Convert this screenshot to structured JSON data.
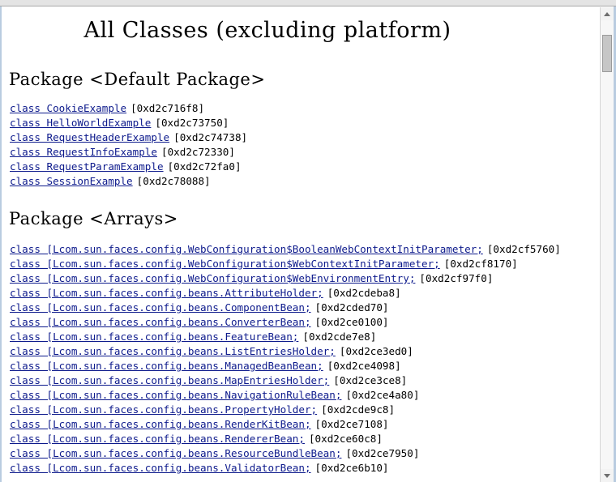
{
  "window": {
    "title": "All Classes (excluding platform)"
  },
  "scrollbar": {
    "up_icon": "arrow-up-icon",
    "down_icon": "arrow-down-icon",
    "thumb": "scroll-thumb"
  },
  "packages": [
    {
      "heading": "Package <Default Package>",
      "classes": [
        {
          "link": "class CookieExample",
          "address": "[0xd2c716f8]"
        },
        {
          "link": "class HelloWorldExample",
          "address": "[0xd2c73750]"
        },
        {
          "link": "class RequestHeaderExample",
          "address": "[0xd2c74738]"
        },
        {
          "link": "class RequestInfoExample",
          "address": "[0xd2c72330]"
        },
        {
          "link": "class RequestParamExample",
          "address": "[0xd2c72fa0]"
        },
        {
          "link": "class SessionExample",
          "address": "[0xd2c78088]"
        }
      ]
    },
    {
      "heading": "Package <Arrays>",
      "classes": [
        {
          "link": "class [Lcom.sun.faces.config.WebConfiguration$BooleanWebContextInitParameter;",
          "address": "[0xd2cf5760]"
        },
        {
          "link": "class [Lcom.sun.faces.config.WebConfiguration$WebContextInitParameter;",
          "address": "[0xd2cf8170]"
        },
        {
          "link": "class [Lcom.sun.faces.config.WebConfiguration$WebEnvironmentEntry;",
          "address": "[0xd2cf97f0]"
        },
        {
          "link": "class [Lcom.sun.faces.config.beans.AttributeHolder;",
          "address": "[0xd2cdeba8]"
        },
        {
          "link": "class [Lcom.sun.faces.config.beans.ComponentBean;",
          "address": "[0xd2cded70]"
        },
        {
          "link": "class [Lcom.sun.faces.config.beans.ConverterBean;",
          "address": "[0xd2ce0100]"
        },
        {
          "link": "class [Lcom.sun.faces.config.beans.FeatureBean;",
          "address": "[0xd2cde7e8]"
        },
        {
          "link": "class [Lcom.sun.faces.config.beans.ListEntriesHolder;",
          "address": "[0xd2ce3ed0]"
        },
        {
          "link": "class [Lcom.sun.faces.config.beans.ManagedBeanBean;",
          "address": "[0xd2ce4098]"
        },
        {
          "link": "class [Lcom.sun.faces.config.beans.MapEntriesHolder;",
          "address": "[0xd2ce3ce8]"
        },
        {
          "link": "class [Lcom.sun.faces.config.beans.NavigationRuleBean;",
          "address": "[0xd2ce4a80]"
        },
        {
          "link": "class [Lcom.sun.faces.config.beans.PropertyHolder;",
          "address": "[0xd2cde9c8]"
        },
        {
          "link": "class [Lcom.sun.faces.config.beans.RenderKitBean;",
          "address": "[0xd2ce7108]"
        },
        {
          "link": "class [Lcom.sun.faces.config.beans.RendererBean;",
          "address": "[0xd2ce60c8]"
        },
        {
          "link": "class [Lcom.sun.faces.config.beans.ResourceBundleBean;",
          "address": "[0xd2ce7950]"
        },
        {
          "link": "class [Lcom.sun.faces.config.beans.ValidatorBean;",
          "address": "[0xd2ce6b10]"
        }
      ]
    }
  ],
  "colors": {
    "link": "#0d1a8c",
    "text": "#000000",
    "background": "#ffffff",
    "chrome": "#e4e4e4",
    "window_border": "#b9cce0"
  }
}
